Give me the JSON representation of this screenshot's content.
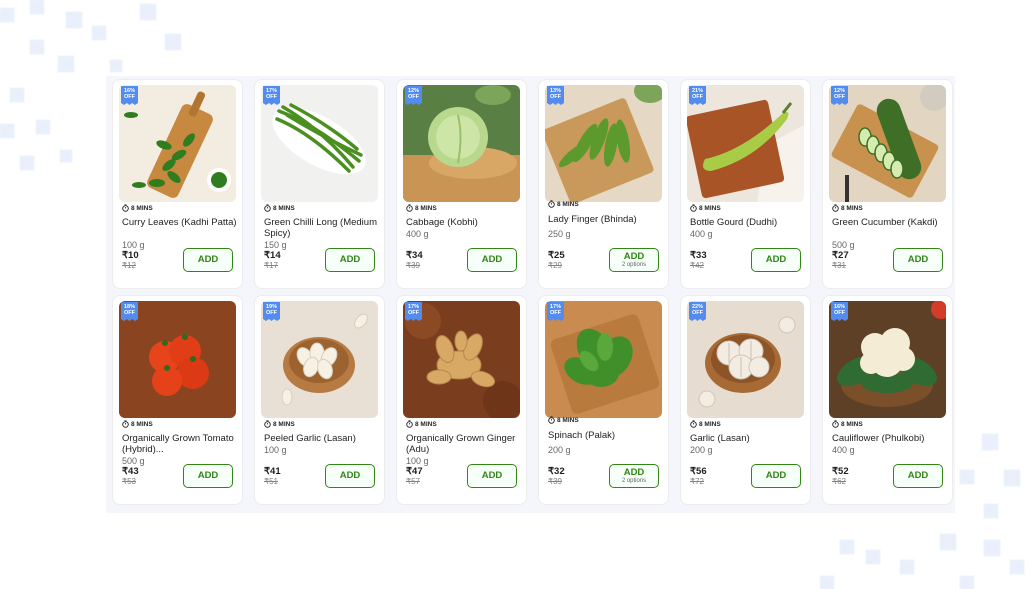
{
  "colors": {
    "accent_green": "#318616",
    "badge_blue": "#538cee",
    "panel_bg": "#f4f6fb"
  },
  "icons": {
    "eta": "stopwatch-icon",
    "badge": "discount-tag-icon"
  },
  "products": [
    {
      "discount": "16%",
      "off_label": "OFF",
      "eta": "8 MINS",
      "name": "Curry Leaves (Kadhi Patta)",
      "quantity": "100 g",
      "price": "₹10",
      "mrp": "₹12",
      "add_label": "ADD",
      "options": ""
    },
    {
      "discount": "17%",
      "off_label": "OFF",
      "eta": "8 MINS",
      "name": "Green Chilli Long (Medium Spicy)",
      "quantity": "150 g",
      "price": "₹14",
      "mrp": "₹17",
      "add_label": "ADD",
      "options": ""
    },
    {
      "discount": "12%",
      "off_label": "OFF",
      "eta": "8 MINS",
      "name": "Cabbage (Kobhi)",
      "quantity": "400 g",
      "price": "₹34",
      "mrp": "₹39",
      "add_label": "ADD",
      "options": ""
    },
    {
      "discount": "13%",
      "off_label": "OFF",
      "eta": "8 MINS",
      "name": "Lady Finger (Bhinda)",
      "quantity": "250 g",
      "price": "₹25",
      "mrp": "₹29",
      "add_label": "ADD",
      "options": "2 options"
    },
    {
      "discount": "21%",
      "off_label": "OFF",
      "eta": "8 MINS",
      "name": "Bottle Gourd (Dudhi)",
      "quantity": "400 g",
      "price": "₹33",
      "mrp": "₹42",
      "add_label": "ADD",
      "options": ""
    },
    {
      "discount": "12%",
      "off_label": "OFF",
      "eta": "8 MINS",
      "name": "Green Cucumber (Kakdi)",
      "quantity": "500 g",
      "price": "₹27",
      "mrp": "₹31",
      "add_label": "ADD",
      "options": ""
    },
    {
      "discount": "18%",
      "off_label": "OFF",
      "eta": "8 MINS",
      "name": "Organically Grown Tomato (Hybrid)...",
      "quantity": "500 g",
      "price": "₹43",
      "mrp": "₹53",
      "add_label": "ADD",
      "options": ""
    },
    {
      "discount": "19%",
      "off_label": "OFF",
      "eta": "8 MINS",
      "name": "Peeled Garlic (Lasan)",
      "quantity": "100 g",
      "price": "₹41",
      "mrp": "₹51",
      "add_label": "ADD",
      "options": ""
    },
    {
      "discount": "17%",
      "off_label": "OFF",
      "eta": "8 MINS",
      "name": "Organically Grown Ginger (Adu)",
      "quantity": "100 g",
      "price": "₹47",
      "mrp": "₹57",
      "add_label": "ADD",
      "options": ""
    },
    {
      "discount": "17%",
      "off_label": "OFF",
      "eta": "8 MINS",
      "name": "Spinach (Palak)",
      "quantity": "200 g",
      "price": "₹32",
      "mrp": "₹39",
      "add_label": "ADD",
      "options": "2 options"
    },
    {
      "discount": "22%",
      "off_label": "OFF",
      "eta": "8 MINS",
      "name": "Garlic (Lasan)",
      "quantity": "200 g",
      "price": "₹56",
      "mrp": "₹72",
      "add_label": "ADD",
      "options": ""
    },
    {
      "discount": "16%",
      "off_label": "OFF",
      "eta": "8 MINS",
      "name": "Cauliflower (Phulkobi)",
      "quantity": "400 g",
      "price": "₹52",
      "mrp": "₹62",
      "add_label": "ADD",
      "options": ""
    }
  ]
}
